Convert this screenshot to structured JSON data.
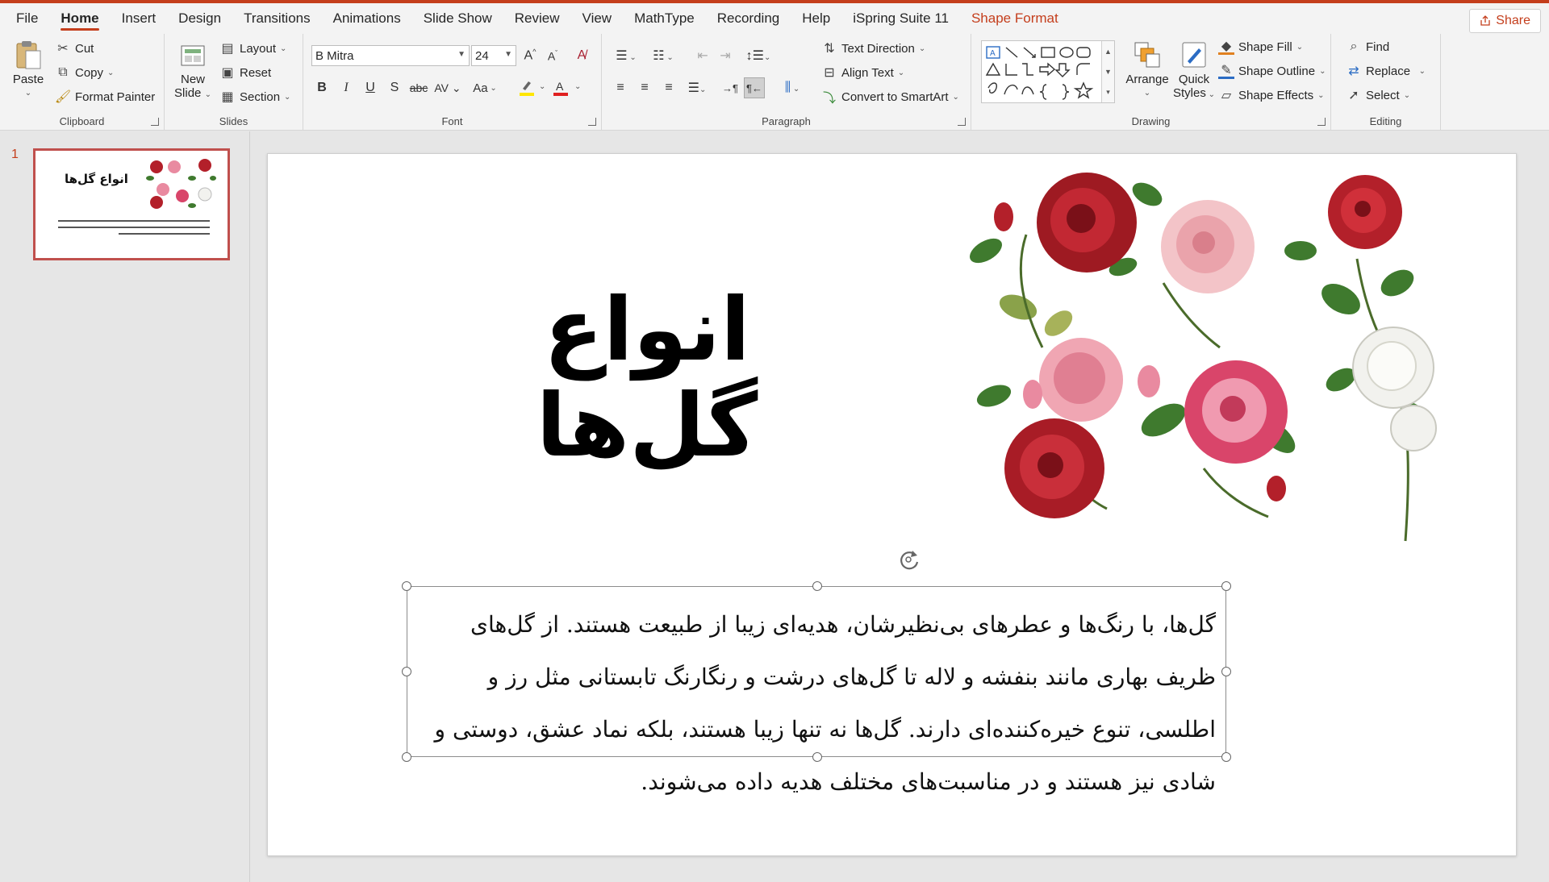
{
  "menu": {
    "tabs": [
      "File",
      "Home",
      "Insert",
      "Design",
      "Transitions",
      "Animations",
      "Slide Show",
      "Review",
      "View",
      "MathType",
      "Recording",
      "Help",
      "iSpring Suite 11",
      "Shape Format"
    ],
    "active": "Home",
    "share_label": "Share"
  },
  "ribbon": {
    "clipboard": {
      "label": "Clipboard",
      "paste": "Paste",
      "cut": "Cut",
      "copy": "Copy",
      "format_painter": "Format Painter"
    },
    "slides": {
      "label": "Slides",
      "new_slide_line1": "New",
      "new_slide_line2": "Slide",
      "layout": "Layout",
      "reset": "Reset",
      "section": "Section"
    },
    "font": {
      "label": "Font",
      "font_name": "B Mitra",
      "font_size": "24",
      "case_label": "Aa"
    },
    "paragraph": {
      "label": "Paragraph",
      "text_direction": "Text Direction",
      "align_text": "Align Text",
      "convert_smartart": "Convert to SmartArt"
    },
    "drawing": {
      "label": "Drawing",
      "arrange": "Arrange",
      "quick_line1": "Quick",
      "quick_line2": "Styles",
      "shape_fill": "Shape Fill",
      "shape_outline": "Shape Outline",
      "shape_effects": "Shape Effects"
    },
    "editing": {
      "label": "Editing",
      "find": "Find",
      "replace": "Replace",
      "select": "Select"
    }
  },
  "thumbnails": {
    "number": "1",
    "title": "انواع گل‌ها"
  },
  "slide": {
    "title": "انواع گل‌ها",
    "body": "گل‌ها، با رنگ‌ها و عطرهای بی‌نظیرشان، هدیه‌ای زیبا از طبیعت هستند. از گل‌های ظریف بهاری مانند بنفشه و لاله تا گل‌های درشت و رنگارنگ تابستانی مثل رز و اطلسی، تنوع خیره‌کننده‌ای دارند. گل‌ها نه تنها زیبا هستند، بلکه نماد عشق، دوستی و شادی نیز هستند و در مناسبت‌های مختلف هدیه داده می‌شوند."
  },
  "colors": {
    "accent": "#c43e1c",
    "rose_red": "#b3202a",
    "rose_pink": "#e98aa0",
    "leaf_green": "#3f7a2e",
    "rose_white": "#f2f2ee"
  }
}
